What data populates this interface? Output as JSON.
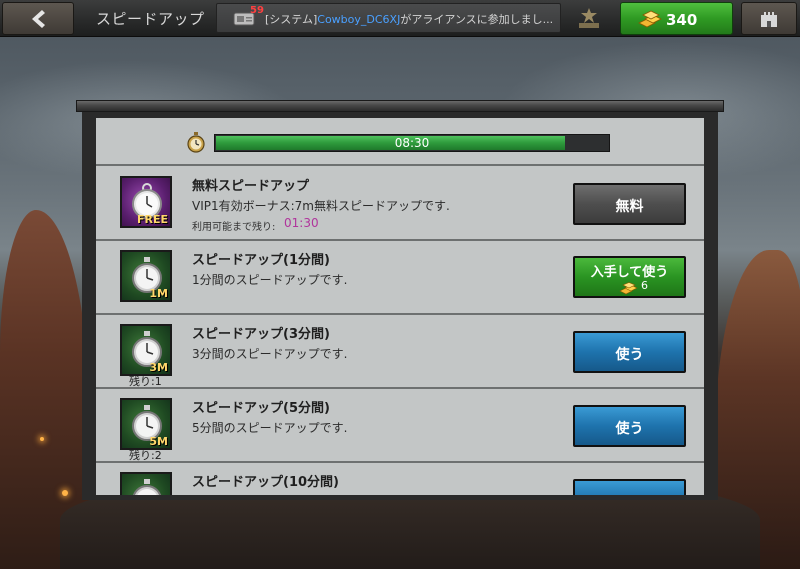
{
  "header": {
    "back_icon": "back-arrow-icon",
    "title": "スピードアップ",
    "ticker": {
      "badge": "59",
      "prefix": "[システム]",
      "player": "Cowboy_DC6XJ",
      "message": "がアライアンスに参加しまし..."
    },
    "gold_amount": "340",
    "menu_icon": "castle-menu-icon",
    "colors": {
      "gold_button": "#2f9a23",
      "player_name": "#4aa0ff",
      "badge": "#ff4040"
    }
  },
  "progress": {
    "time": "08:30",
    "fill_fraction": 0.89
  },
  "items": [
    {
      "name": "無料スピードアップ",
      "desc": "VIP1有効ボーナス:7m無料スピードアップです.",
      "avail_label": "利用可能まで残り:",
      "avail_time": "01:30",
      "icon_label": "FREE",
      "button": {
        "label": "無料",
        "style": "gray"
      }
    },
    {
      "name": "スピードアップ(1分間)",
      "desc": "1分間のスピードアップです.",
      "icon_label": "1M",
      "button": {
        "label": "入手して使う",
        "cost": "6",
        "style": "green"
      }
    },
    {
      "name": "スピードアップ(3分間)",
      "desc": "3分間のスピードアップです.",
      "icon_label": "3M",
      "remaining": "残り:1",
      "button": {
        "label": "使う",
        "style": "blue"
      }
    },
    {
      "name": "スピードアップ(5分間)",
      "desc": "5分間のスピードアップです.",
      "icon_label": "5M",
      "remaining": "残り:2",
      "button": {
        "label": "使う",
        "style": "blue"
      }
    },
    {
      "name": "スピードアップ(10分間)",
      "desc": "",
      "icon_label": "",
      "button": {
        "label": "",
        "style": "blue"
      }
    }
  ]
}
